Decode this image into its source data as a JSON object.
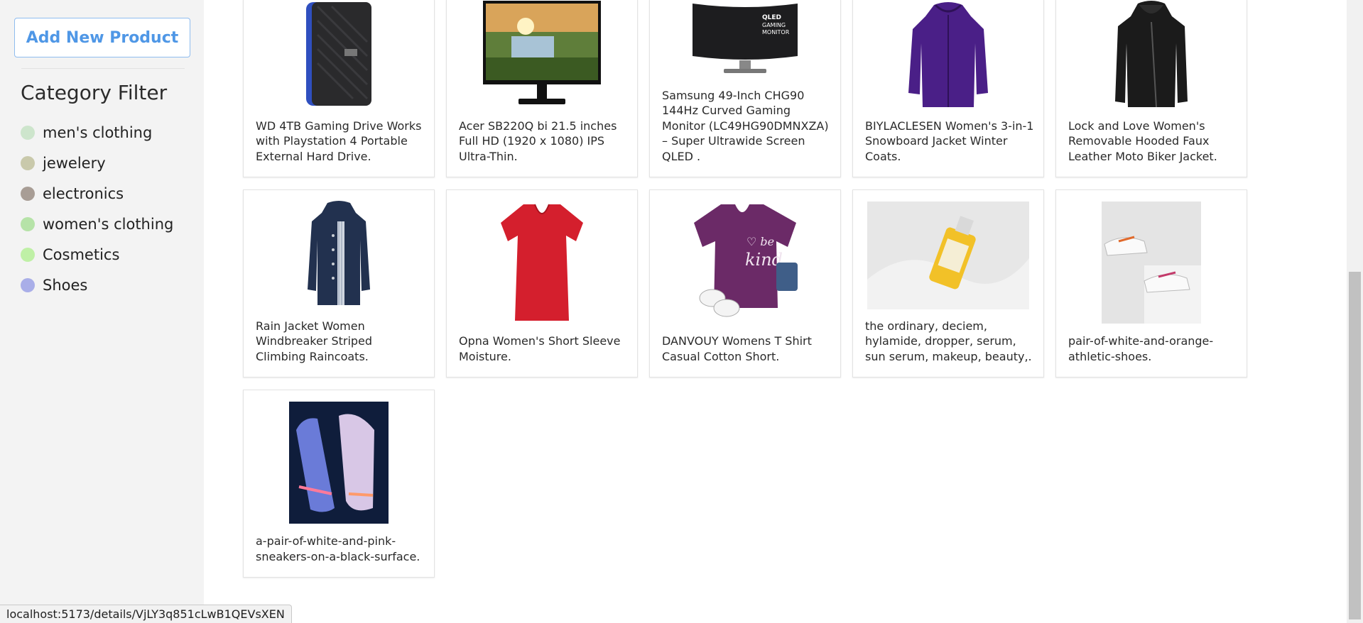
{
  "sidebar": {
    "add_button": "Add New Product",
    "category_title": "Category Filter",
    "categories": [
      {
        "label": "men's clothing",
        "color": "#cde5cc"
      },
      {
        "label": "jewelery",
        "color": "#c9c9ab"
      },
      {
        "label": "electronics",
        "color": "#a89d95"
      },
      {
        "label": "women's clothing",
        "color": "#b6e3a8"
      },
      {
        "label": "Cosmetics",
        "color": "#bff0a6"
      },
      {
        "label": "Shoes",
        "color": "#a9aee8"
      }
    ]
  },
  "products": [
    {
      "title": "WD 4TB Gaming Drive Works with Playstation 4 Portable External Hard Drive.",
      "icon": "hard-drive-image"
    },
    {
      "title": "Acer SB220Q bi 21.5 inches Full HD (1920 x 1080) IPS Ultra-Thin.",
      "icon": "monitor-image"
    },
    {
      "title": "Samsung 49-Inch CHG90 144Hz Curved Gaming Monitor (LC49HG90DMNXZA) – Super Ultrawide Screen QLED .",
      "icon": "curved-monitor-image",
      "screen_text": "QLED GAMING MONITOR"
    },
    {
      "title": "BIYLACLESEN Women's 3-in-1 Snowboard Jacket Winter Coats.",
      "icon": "purple-jacket-image"
    },
    {
      "title": "Lock and Love Women's Removable Hooded Faux Leather Moto Biker Jacket.",
      "icon": "leather-jacket-image"
    },
    {
      "title": "Rain Jacket Women Windbreaker Striped Climbing Raincoats.",
      "icon": "rain-jacket-image"
    },
    {
      "title": "Opna Women's Short Sleeve Moisture.",
      "icon": "red-tshirt-image"
    },
    {
      "title": "DANVOUY Womens T Shirt Casual Cotton Short.",
      "icon": "purple-tshirt-image",
      "print_text": "be kind"
    },
    {
      "title": "the ordinary, deciem, hylamide, dropper, serum, sun serum, makeup, beauty,.",
      "icon": "serum-bottle-image"
    },
    {
      "title": "pair-of-white-and-orange-athletic-shoes.",
      "icon": "white-orange-shoes-image"
    },
    {
      "title": "a-pair-of-white-and-pink-sneakers-on-a-black-surface.",
      "icon": "pink-sneakers-image"
    }
  ],
  "status_bar": {
    "url": "localhost:5173/details/VjLY3q851cLwB1QEVsXEN"
  }
}
